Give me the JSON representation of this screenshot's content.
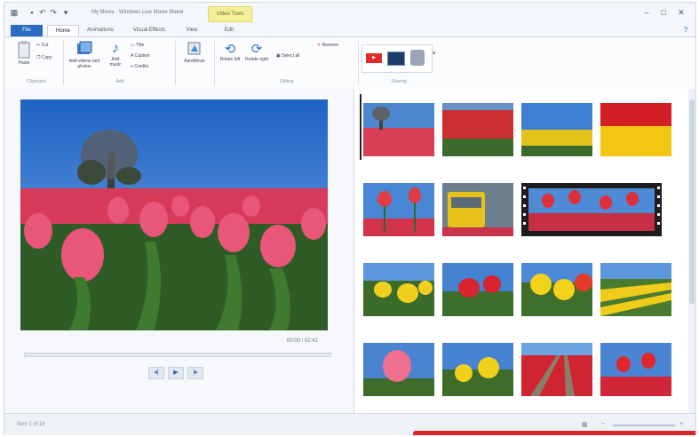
{
  "window": {
    "title": "My Movie - Windows Live Movie Maker",
    "contextual_tab": "Video Tools"
  },
  "tabs": {
    "file": "File",
    "items": [
      "Home",
      "Animations",
      "Visual Effects",
      "View",
      "Edit"
    ]
  },
  "ribbon": {
    "clipboard": {
      "paste": "Paste",
      "cut": "Cut",
      "copy": "Copy",
      "label": "Clipboard"
    },
    "add": {
      "add_videos": "Add videos and photos",
      "add_music": "Add music",
      "title": "Title",
      "caption": "Caption",
      "credits": "Credits",
      "label": "Add"
    },
    "automovie": "AutoMovie",
    "editing": {
      "rotate_left": "Rotate left",
      "rotate_right": "Rotate right",
      "select_all": "Select all",
      "remove": "Remove",
      "label": "Editing"
    },
    "sharing": {
      "label": "Sharing"
    }
  },
  "player": {
    "time": "00:00 / 02:41",
    "previous": "Previous frame",
    "play": "Play",
    "next": "Next frame"
  },
  "status": {
    "text": "Item 1 of 16"
  },
  "colors": {
    "file_tab": "#2b6cc2",
    "contextual_tab": "#f6ef9a",
    "accent_red": "#d8262a"
  }
}
